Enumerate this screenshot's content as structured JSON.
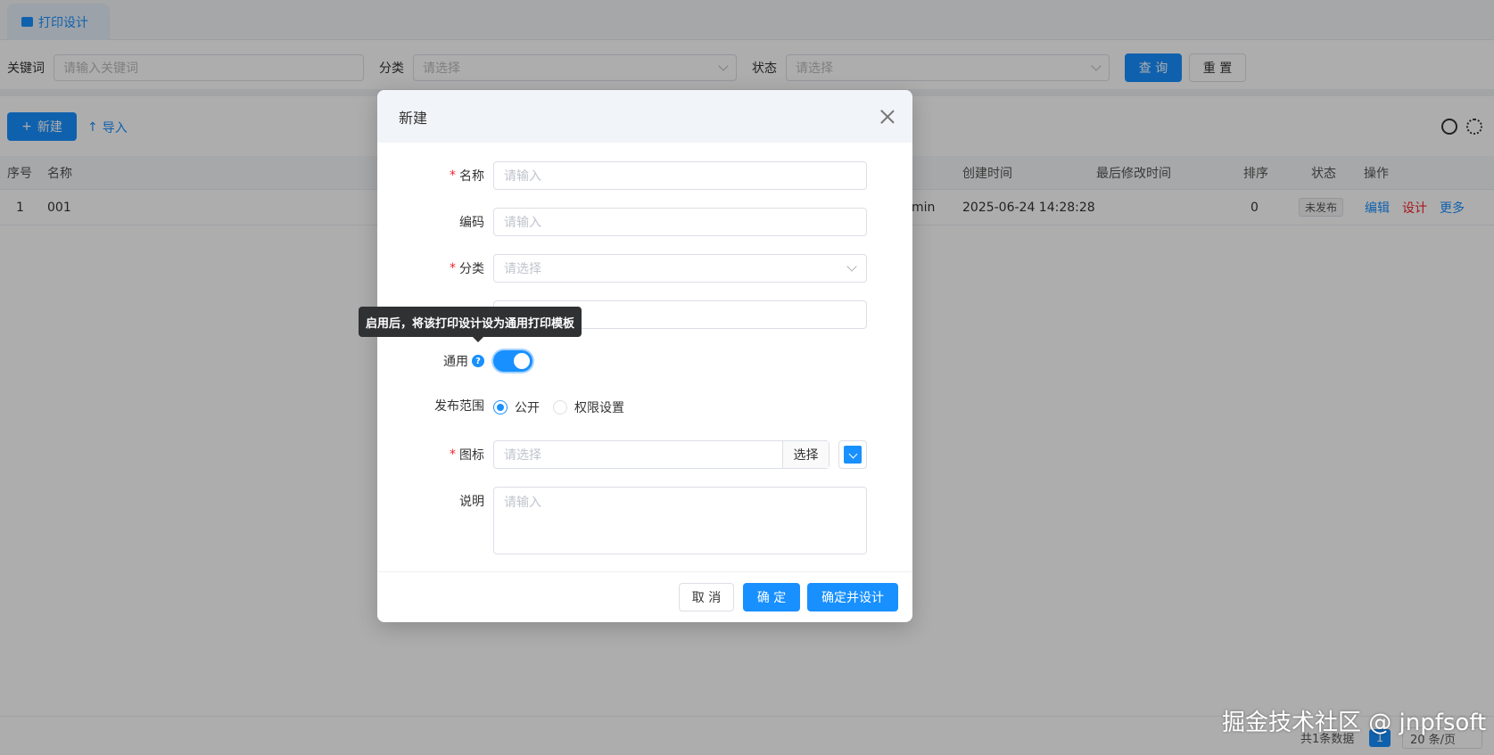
{
  "tab": {
    "label": "打印设计"
  },
  "search": {
    "keyword_label": "关键词",
    "keyword_placeholder": "请输入关键词",
    "category_label": "分类",
    "category_placeholder": "请选择",
    "status_label": "状态",
    "status_placeholder": "请选择",
    "query_label": "查 询",
    "reset_label": "重 置"
  },
  "toolbar": {
    "new_label": "新建",
    "import_label": "导入"
  },
  "table": {
    "columns": [
      "序号",
      "名称",
      "创建时间",
      "最后修改时间",
      "排序",
      "状态",
      "操作"
    ],
    "rows": [
      {
        "index": "1",
        "name": "001",
        "creator": "min",
        "created": "2025-06-24 14:28:28",
        "modified": "",
        "sort": "0",
        "status": "未发布",
        "actions": {
          "edit": "编辑",
          "design": "设计",
          "more": "更多"
        }
      }
    ]
  },
  "pagination": {
    "total": "共1条数据",
    "page": "1",
    "size": "20 条/页"
  },
  "watermark": "掘金技术社区 @ jnpfsoft",
  "modal": {
    "title": "新建",
    "fields": {
      "name_label": "名称",
      "name_placeholder": "请输入",
      "code_label": "编码",
      "code_placeholder": "请输入",
      "category_label": "分类",
      "category_placeholder": "请选择",
      "common_label": "通用",
      "common_enabled": true,
      "scope_label": "发布范围",
      "scope_options": [
        "公开",
        "权限设置"
      ],
      "scope_selected": "公开",
      "icon_label": "图标",
      "icon_placeholder": "请选择",
      "icon_pick_label": "选择",
      "icon_color": "#1890ff",
      "desc_label": "说明",
      "desc_placeholder": "请输入"
    },
    "tooltip": "启用后，将该打印设计设为通用打印模板",
    "buttons": {
      "cancel": "取 消",
      "ok": "确 定",
      "ok_design": "确定并设计"
    }
  }
}
